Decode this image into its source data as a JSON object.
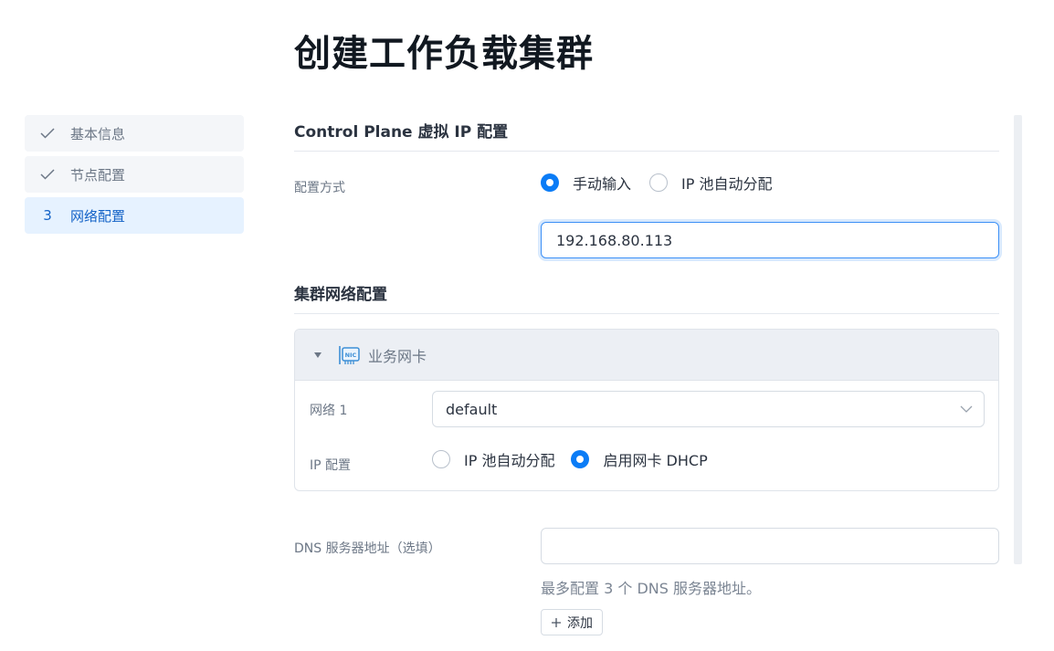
{
  "page": {
    "title": "创建工作负载集群"
  },
  "steps": [
    {
      "mark": "✓",
      "label": "基本信息",
      "state": "done"
    },
    {
      "mark": "✓",
      "label": "节点配置",
      "state": "done"
    },
    {
      "mark": "3",
      "label": "网络配置",
      "state": "active"
    }
  ],
  "control_plane": {
    "title": "Control Plane 虚拟 IP 配置",
    "mode_label": "配置方式",
    "options": [
      "手动输入",
      "IP 池自动分配"
    ],
    "selected": "手动输入",
    "ip_value": "192.168.80.113"
  },
  "cluster_network": {
    "title": "集群网络配置",
    "nic": {
      "title": "业务网卡",
      "icon": "nic-icon",
      "expanded": true,
      "network_label": "网络 1",
      "network_value": "default",
      "ip_label": "IP 配置",
      "ip_options": [
        "IP 池自动分配",
        "启用网卡 DHCP"
      ],
      "ip_selected": "启用网卡 DHCP"
    }
  },
  "dns": {
    "label": "DNS 服务器地址（选填）",
    "value": "",
    "hint": "最多配置 3 个 DNS 服务器地址。",
    "add_label": "添加"
  },
  "colors": {
    "accent": "#0b7cf6",
    "active_step_bg": "#e6f2ff",
    "active_step_text": "#1463c7"
  }
}
